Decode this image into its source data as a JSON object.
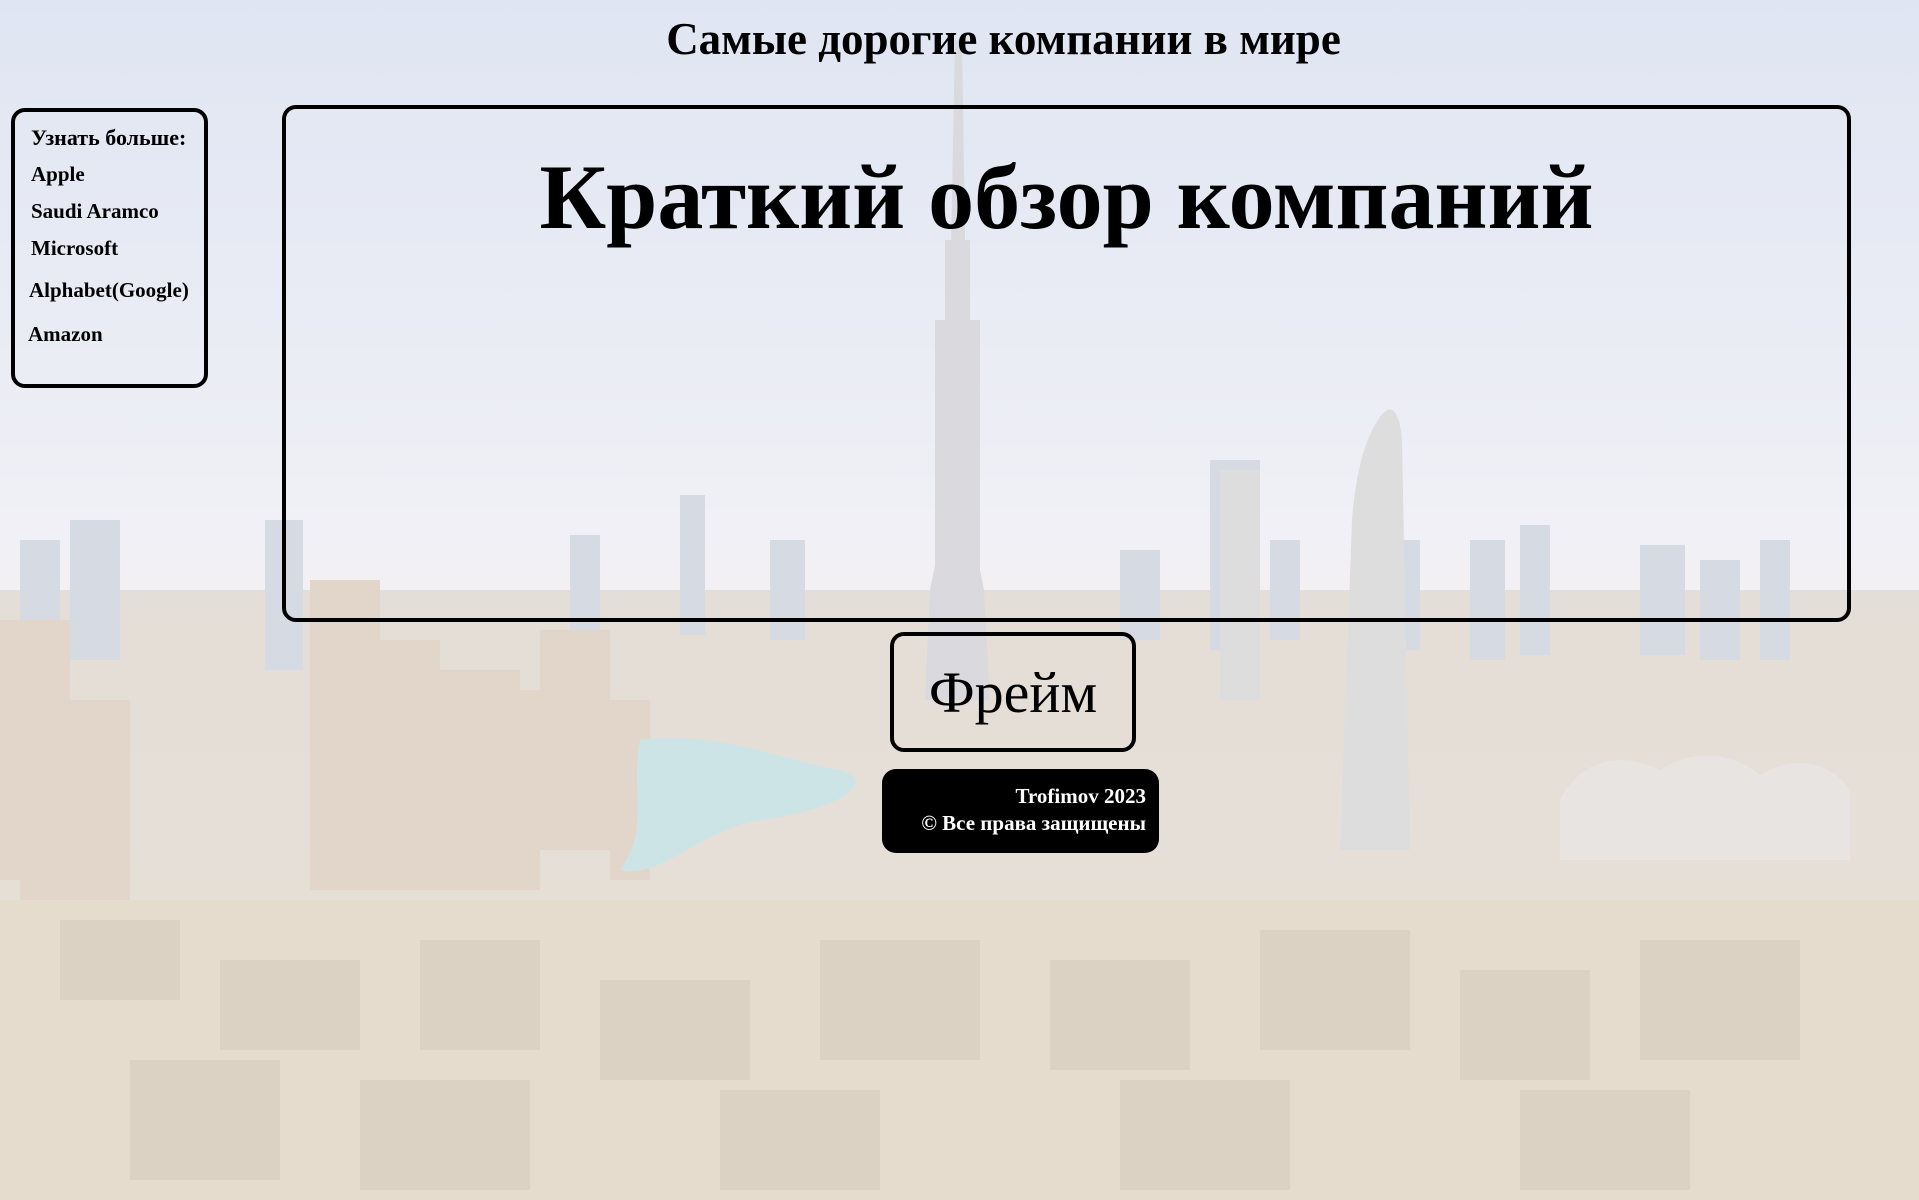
{
  "page": {
    "title": "Самые дорогие компании в мире"
  },
  "sidebar": {
    "heading": "Узнать больше:",
    "items": [
      {
        "label": "Apple"
      },
      {
        "label": "Saudi Aramco"
      },
      {
        "label": "Microsoft"
      },
      {
        "label": "Alphabet(Google)"
      },
      {
        "label": "Amazon"
      }
    ]
  },
  "main": {
    "heading": "Краткий обзор компаний"
  },
  "frame_button": {
    "label": "Фрейм"
  },
  "footer": {
    "line1": "Trofimov 2023",
    "line2": "© Все права защищены"
  },
  "colors": {
    "border": "#000000",
    "footer_bg": "#000000",
    "footer_text": "#ffffff",
    "sky_top": "#cfd7ea",
    "sky_bottom": "#efe7e0",
    "buildings": "#d8cfc2"
  },
  "background": {
    "icon": "city-skyline-image"
  }
}
